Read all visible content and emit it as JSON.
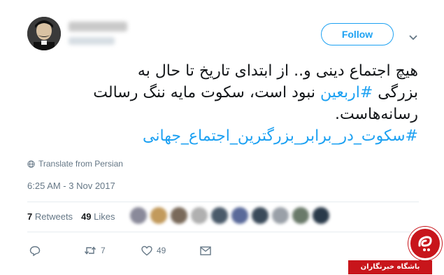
{
  "header": {
    "follow_label": "Follow",
    "icons": {
      "menu": "chevron-down-icon"
    }
  },
  "tweet": {
    "lines": [
      {
        "segments": [
          {
            "text": "هیچ اجتماع دینی و.. از ابتدای تاریخ تا حال به",
            "type": "text"
          }
        ]
      },
      {
        "segments": [
          {
            "text": "بزرگی ",
            "type": "text"
          },
          {
            "text": "#اربعین",
            "type": "hashtag"
          },
          {
            "text": " نبود است، سکوت مایه ننگ رسالت",
            "type": "text"
          }
        ]
      },
      {
        "segments": [
          {
            "text": "رسانه‌هاست.",
            "type": "text"
          }
        ]
      },
      {
        "segments": [
          {
            "text": "#سکوت_در_برابر_بزرگترین_اجتماع_جهانی",
            "type": "hashtag"
          }
        ]
      }
    ],
    "translate_label": "Translate from Persian",
    "timestamp": "6:25 AM - 3 Nov 2017"
  },
  "stats": {
    "retweets_count": "7",
    "retweets_label": "Retweets",
    "likes_count": "49",
    "likes_label": "Likes"
  },
  "actions": {
    "reply_icon": "reply-icon",
    "retweet_icon": "retweet-icon",
    "retweet_count": "7",
    "like_icon": "heart-icon",
    "like_count": "49",
    "dm_icon": "envelope-icon"
  },
  "watermark": {
    "text": "باشگاه خبرنگاران"
  },
  "colors": {
    "accent": "#1da1f2",
    "muted": "#657786",
    "brand_red": "#c8151b"
  }
}
